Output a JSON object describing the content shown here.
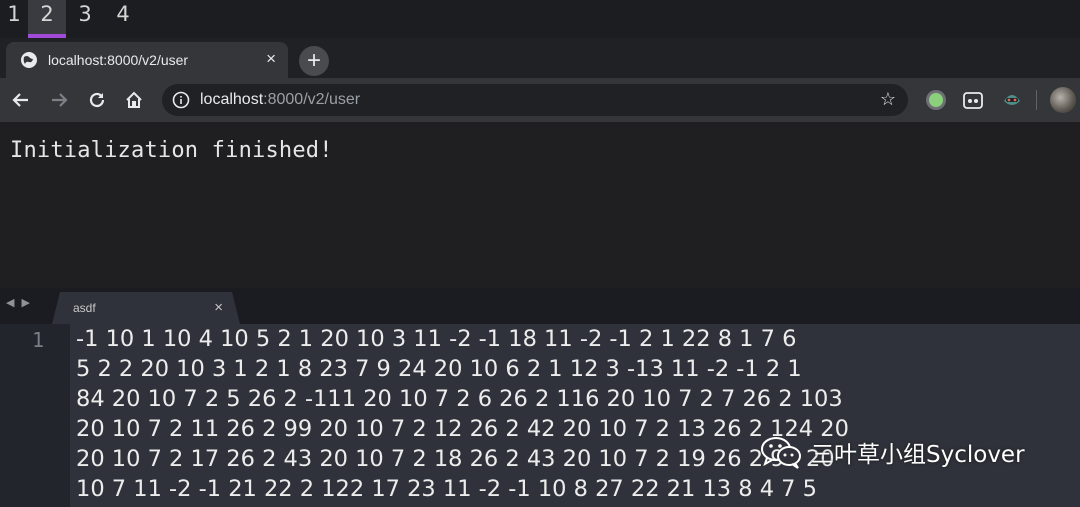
{
  "workspaces": [
    "1",
    "2",
    "3",
    "4"
  ],
  "browser_tab": {
    "title": "localhost:8000/v2/user",
    "close_glyph": "×"
  },
  "new_tab_glyph": "+",
  "address_bar": {
    "host": "localhost",
    "path": ":8000/v2/user"
  },
  "page": {
    "message": "Initialization finished!"
  },
  "editor": {
    "tab_name": "asdf",
    "close_glyph": "×",
    "line_number": "1",
    "lines": [
      "-1 10 1 10 4 10 5 2 1 20 10 3 11 -2 -1 18 11 -2 -1 2 1 22 8 1 7 6",
      "5 2 2 20 10 3 1 2 1 8 23 7 9 24 20 10 6 2 1 12 3 -13 11 -2 -1 2 1",
      "84 20 10 7 2 5 26 2 -111 20 10 7 2 6 26 2 116 20 10 7 2 7 26 2 103",
      "20 10 7 2 11 26 2 99 20 10 7 2 12 26 2 42 20 10 7 2 13 26 2 124 20",
      "20 10 7 2 17 26 2 43 20 10 7 2 18 26 2 43 20 10 7 2 19 26 2 97 20",
      "10 7 11 -2 -1 21 22 2 122 17 23 11 -2 -1 10 8 27 22 21 13 8 4 7 5"
    ]
  },
  "watermark": {
    "text": "三叶草小组Syclover"
  },
  "colors": {
    "workspace_accent": "#a24bd9",
    "extension_green": "#8bd17c"
  }
}
